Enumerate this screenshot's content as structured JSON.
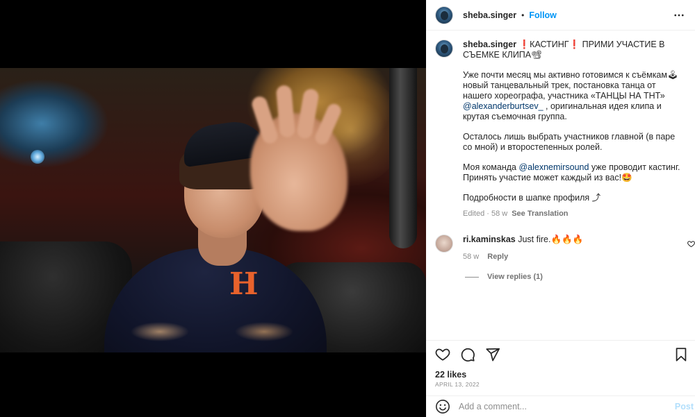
{
  "post": {
    "username": "sheba.singer",
    "follow_label": "Follow",
    "separator": "•",
    "more_icon": "more-horizontal-icon"
  },
  "caption": {
    "username": "sheba.singer",
    "line1": "❗КАСТИНГ❗ ПРИМИ УЧАСТИЕ В СЪЕМКЕ КЛИПА📽",
    "p1_a": "Уже почти месяц мы активно готовимся к съёмкам🕹 новый танцевальный трек, постановка танца от нашего хореографа, участника «ТАНЦЫ НА ТНТ» ",
    "p1_mention": "@alexanderburtsev_",
    "p1_b": " , оригинальная идея клипа и крутая съемочная группа.",
    "p2": "Осталось лишь выбрать участников главной (в паре со мной) и второстепенных ролей.",
    "p3_a": "Моя команда ",
    "p3_mention": "@alexnemirsound",
    "p3_b": " уже проводит кастинг. Принять участие может каждый из вас!🤩",
    "p4": "Подробности в шапке профиля ⤴",
    "meta_time": "Edited · 58 w",
    "see_translation": "See Translation"
  },
  "comments": [
    {
      "username": "ri.kaminskas",
      "text": " Just fire.🔥🔥🔥",
      "time": "58 w",
      "reply_label": "Reply",
      "view_replies": "View replies (1)"
    }
  ],
  "engagement": {
    "likes": "22 likes",
    "date": "April 13, 2022"
  },
  "composer": {
    "placeholder": "Add a comment...",
    "post_label": "Post"
  },
  "colors": {
    "accent": "#0095f6",
    "mention": "#00376b",
    "muted": "#8e8e8e",
    "post_disabled": "#b2dffc"
  }
}
